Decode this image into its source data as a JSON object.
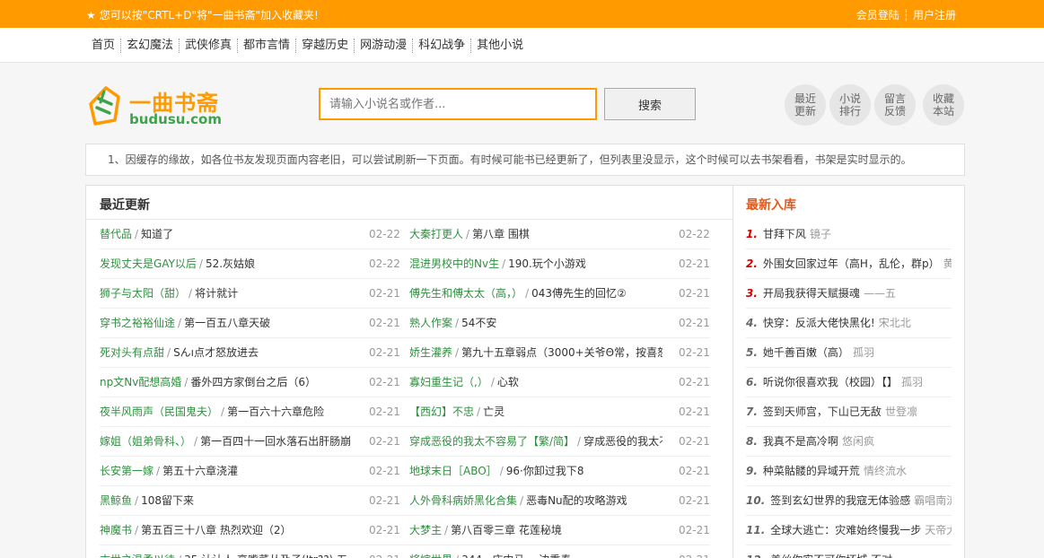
{
  "topbar": {
    "favorite_text": "您可以按\"CRTL+D\"将\"一曲书斋\"加入收藏夹!",
    "login": "会员登陆",
    "register": "用户注册"
  },
  "nav": [
    "首页",
    "玄幻魔法",
    "武侠修真",
    "都市言情",
    "穿越历史",
    "网游动漫",
    "科幻战争",
    "其他小说"
  ],
  "logo": {
    "cn": "一曲书斋",
    "en": "budusu.com"
  },
  "search": {
    "placeholder": "请输入小说名或作者...",
    "button": "搜索"
  },
  "quick_links": [
    {
      "l1": "最近",
      "l2": "更新"
    },
    {
      "l1": "小说",
      "l2": "排行"
    },
    {
      "l1": "留言",
      "l2": "反馈"
    },
    {
      "l1": "收藏",
      "l2": "本站"
    }
  ],
  "notice": "1、因缓存的缘故，如各位书友发现页面内容老旧，可以尝试刷新一下页面。有时候可能书已经更新了，但列表里没显示，这个时候可以去书架看看，书架是实时显示的。",
  "recent": {
    "title": "最近更新",
    "rows": [
      {
        "b1": "替代品",
        "ch1": "知道了",
        "d1": "02-22",
        "b2": "大秦打更人",
        "ch2": "第八章 围棋",
        "d2": "02-22"
      },
      {
        "b1": "发现丈夫是GAY以后",
        "ch1": "52.灰姑娘",
        "d1": "02-22",
        "b2": "混进男校中的Nv生",
        "ch2": "190.玩个小游戏",
        "d2": "02-21"
      },
      {
        "b1": "狮子与太阳（甜）",
        "ch1": "将计就计",
        "d1": "02-21",
        "b2": "傅先生和傅太太（高，）",
        "ch2": "043傅先生的回忆②",
        "d2": "02-21"
      },
      {
        "b1": "穿书之裕裕仙途",
        "ch1": "第一百五八章天破",
        "d1": "02-21",
        "b2": "熟人作案",
        "ch2": "54不安",
        "d2": "02-21"
      },
      {
        "b1": "死对头有点甜",
        "ch1": "Sんı点才怒放进去",
        "d1": "02-21",
        "b2": "娇生灌养",
        "ch2": "第九十五章弱点（3000+关爷Θ常，按喜怒",
        "d2": "02-21"
      },
      {
        "b1": "np文Nv配想高婚",
        "ch1": "番外四方家倒台之后（6）",
        "d1": "02-21",
        "b2": "寡妇重生记（,）",
        "ch2": "心软",
        "d2": "02-21"
      },
      {
        "b1": "夜半风雨声（民国鬼夫）",
        "ch1": "第一百六十六章危险",
        "d1": "02-21",
        "b2": "【西幻】不忠",
        "ch2": "亡灵",
        "d2": "02-21"
      },
      {
        "b1": "嫁姐（姐弟骨科、）",
        "ch1": "第一百四十一回水落石出肝肠崩",
        "d1": "02-21",
        "b2": "穿成恶役的我太不容易了【繁/简】",
        "ch2": "穿成恶役的我太不",
        "d2": "02-21"
      },
      {
        "b1": "长安第一嫁",
        "ch1": "第五十六章浇灌",
        "d1": "02-21",
        "b2": "地球末日［ABO］",
        "ch2": "96·你卸过我下8",
        "d2": "02-21"
      },
      {
        "b1": "黑鲸鱼",
        "ch1": "108留下来",
        "d1": "02-21",
        "b2": "人外骨科病娇黑化合集",
        "ch2": "恶毒Nu配的攻略游戏",
        "d2": "02-21"
      },
      {
        "b1": "神魔书",
        "ch1": "第五百三十八章 热烈欢迎（2）",
        "d1": "02-21",
        "b2": "大梦主",
        "ch2": "第八百零三章 花莲秘境",
        "d2": "02-21"
      },
      {
        "b1": "末世之温柔以待",
        "ch1": "35 认认人 高嘴菜丛及子(Jtr??)  五…",
        "d1": "02-21",
        "b2": "将嫁世界",
        "ch2": "344 · 床中马 一边重奏",
        "d2": "02-21"
      }
    ]
  },
  "newest": {
    "title": "最新入库",
    "rows": [
      {
        "num": "1.",
        "name": "甘拜下风",
        "author": "镜子"
      },
      {
        "num": "2.",
        "name": "外围女回家过年（高H，乱伦，群p）",
        "author": "黄"
      },
      {
        "num": "3.",
        "name": "开局我获得天赋摄魂",
        "author": "——五"
      },
      {
        "num": "4.",
        "name": "快穿：反派大佬快黑化!",
        "author": "宋北北"
      },
      {
        "num": "5.",
        "name": "她千善百嫩（高）",
        "author": "孤羽"
      },
      {
        "num": "6.",
        "name": "听说你很喜欢我（校园）【】",
        "author": "孤羽"
      },
      {
        "num": "7.",
        "name": "签到天师宫，下山已无敌",
        "author": "世登凛"
      },
      {
        "num": "8.",
        "name": "我真不是高冷啊",
        "author": "悠闲疯"
      },
      {
        "num": "9.",
        "name": "种菜骷髅的异域开荒",
        "author": "情终流水"
      },
      {
        "num": "10.",
        "name": "签到玄幻世界的我寇无体验感",
        "author": "霸唱南流"
      },
      {
        "num": "11.",
        "name": "全球大逃亡：灾难始终慢我一步",
        "author": "天帝大"
      },
      {
        "num": "12.",
        "name": "美丝你实不可你坏城 不对",
        "author": ""
      }
    ]
  },
  "colors": {
    "accent": "#ff9a00",
    "book_link": "#2f8f3f",
    "newest_title": "#e25a1c",
    "rank_top": "#d40000"
  }
}
